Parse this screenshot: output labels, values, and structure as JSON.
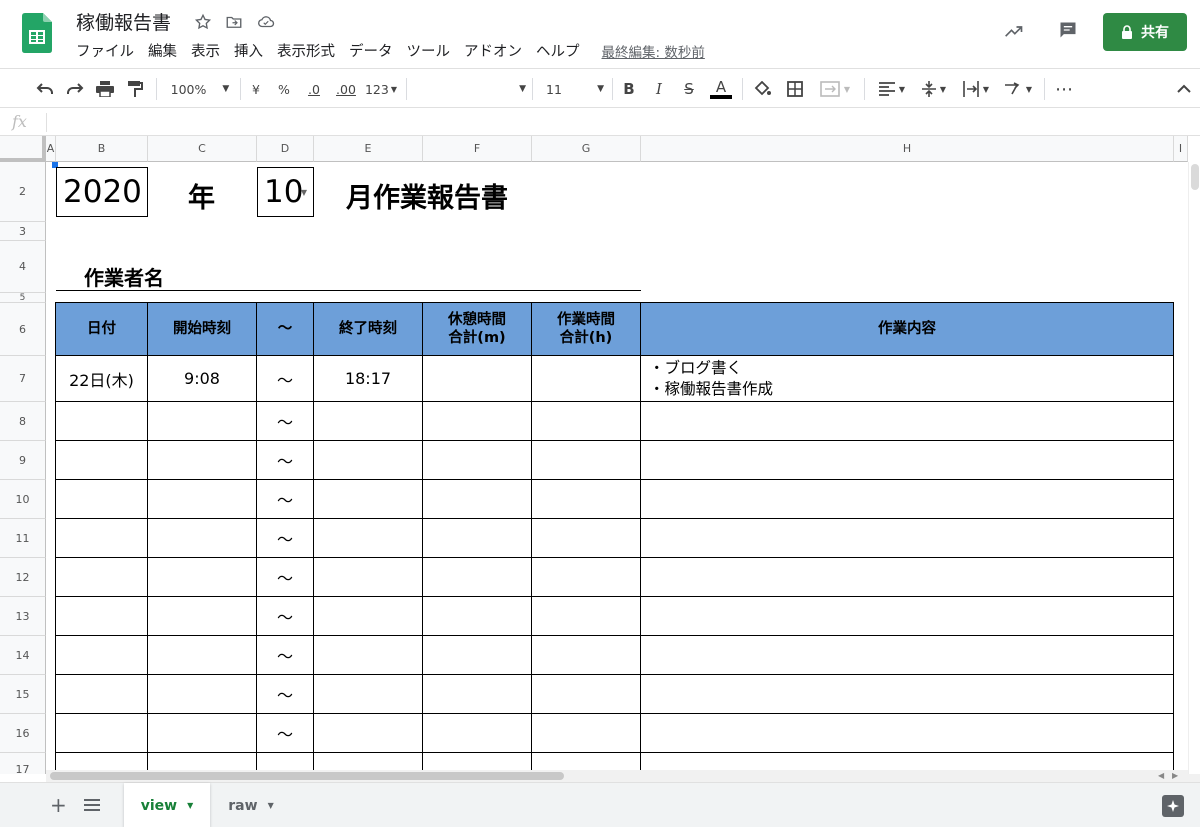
{
  "app": {
    "doc_title": "稼働報告書",
    "menu": [
      "ファイル",
      "編集",
      "表示",
      "挿入",
      "表示形式",
      "データ",
      "ツール",
      "アドオン",
      "ヘルプ"
    ],
    "last_edit": "最終編集: 数秒前",
    "share_label": "共有",
    "colors": {
      "accent": "#2f8a44",
      "header_fill": "#6d9fd9"
    }
  },
  "toolbar": {
    "zoom": "100%",
    "currency": "¥",
    "percent": "%",
    "dec_decrease": ".0",
    "dec_increase": ".00",
    "more_formats": "123",
    "font_size": "11",
    "bold": "B",
    "italic": "I",
    "strike": "S",
    "text_color": "A",
    "more": "⋯"
  },
  "formula_bar": {
    "fx": "fx",
    "content": ""
  },
  "grid": {
    "columns": [
      "A",
      "B",
      "C",
      "D",
      "E",
      "F",
      "G",
      "H",
      "I"
    ],
    "rows": [
      "2",
      "3",
      "4",
      "5",
      "6",
      "7",
      "8",
      "9",
      "10",
      "11",
      "12",
      "13",
      "14",
      "15",
      "16",
      "17"
    ]
  },
  "sheet": {
    "year": "2020",
    "year_suffix": "年",
    "month": "10",
    "title_suffix": "月作業報告書",
    "worker_label": "作業者名",
    "headers": [
      "日付",
      "開始時刻",
      "〜",
      "終了時刻",
      "休憩時間\n合計(m)",
      "作業時間\n合計(h)",
      "作業内容"
    ],
    "first_row": {
      "date": "22日(木)",
      "start": "9:08",
      "tilde": "〜",
      "end": "18:17",
      "break": "",
      "worktime": "",
      "content_lines": [
        "・ブログ書く",
        "・稼働報告書作成"
      ]
    },
    "tilde": "〜"
  },
  "tabs": [
    {
      "name": "view",
      "active": true
    },
    {
      "name": "raw",
      "active": false
    }
  ]
}
